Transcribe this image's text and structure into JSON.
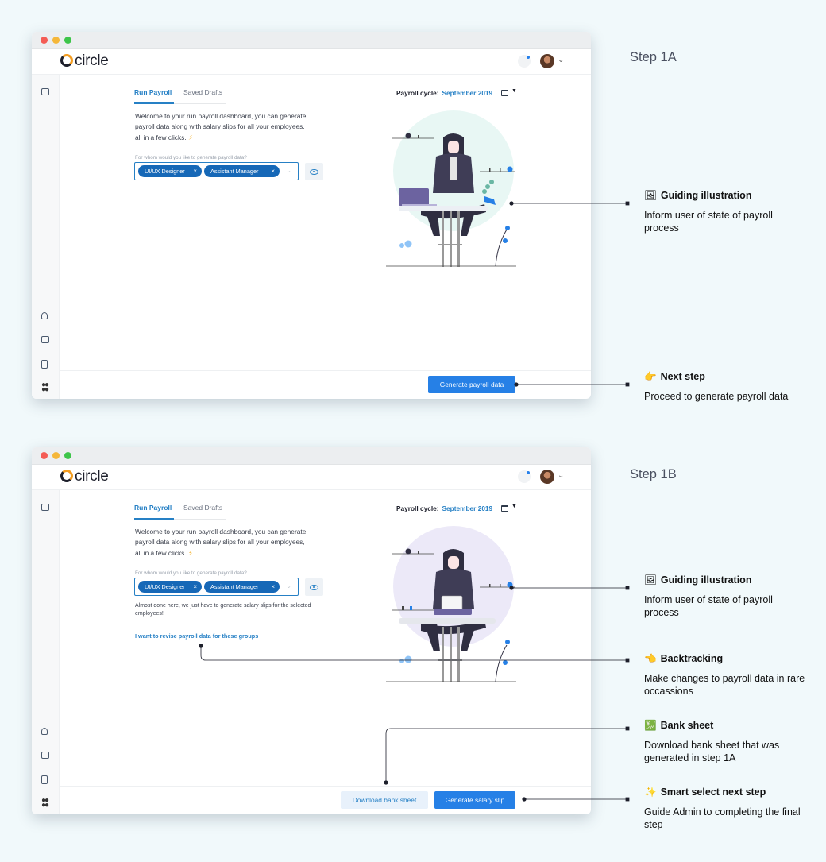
{
  "app": {
    "name": "circle"
  },
  "labels": {
    "step_a": "Step 1A",
    "step_b": "Step 1B"
  },
  "tabs": [
    {
      "label": "Run Payroll"
    },
    {
      "label": "Saved Drafts"
    }
  ],
  "intro": "Welcome to your run payroll dashboard, you can generate payroll data along with salary slips for all your employees, all in a few clicks.",
  "intro_emoji": "⚡",
  "field_label": "For whom would you like to generate payroll data?",
  "chips": [
    {
      "label": "UI/UX Designer"
    },
    {
      "label": "Assistant Manager"
    }
  ],
  "chip_remove": "×",
  "payroll_cycle": {
    "label": "Payroll cycle:",
    "value": "September 2019"
  },
  "almost_text": "Almost done here, we just have to generate salary slips for the selected employees!",
  "revise_link": "I want to revise payroll data for these groups",
  "buttons": {
    "generate_payroll": "Generate payroll data",
    "download_bank": "Download bank sheet",
    "generate_slip": "Generate salary slip"
  },
  "annotations": [
    {
      "emoji": "🖼",
      "title": "Guiding illustration",
      "body": "Inform user of state of payroll process"
    },
    {
      "emoji": "👉",
      "title": "Next step",
      "body": "Proceed to generate payroll data"
    },
    {
      "emoji": "🖼",
      "title": "Guiding illustration",
      "body": "Inform user of state of payroll process"
    },
    {
      "emoji": "👈",
      "title": "Backtracking",
      "body": "Make changes to payroll data in rare occassions"
    },
    {
      "emoji": "💹",
      "title": "Bank sheet",
      "body": "Download bank sheet that was generated in step 1A"
    },
    {
      "emoji": "✨",
      "title": "Smart select next step",
      "body": "Guide Admin to completing the final step"
    }
  ],
  "icons": [
    "notification-bell-icon",
    "user-avatar",
    "chevron-down-icon",
    "monitor-icon",
    "user-icon",
    "mail-icon",
    "document-icon",
    "apps-grid-icon",
    "calendar-icon",
    "eye-icon",
    "close-icon"
  ],
  "colors": {
    "primary": "#2680e6",
    "accent": "#2680c5",
    "chip": "#1668b7",
    "background": "#f1f9fb"
  }
}
